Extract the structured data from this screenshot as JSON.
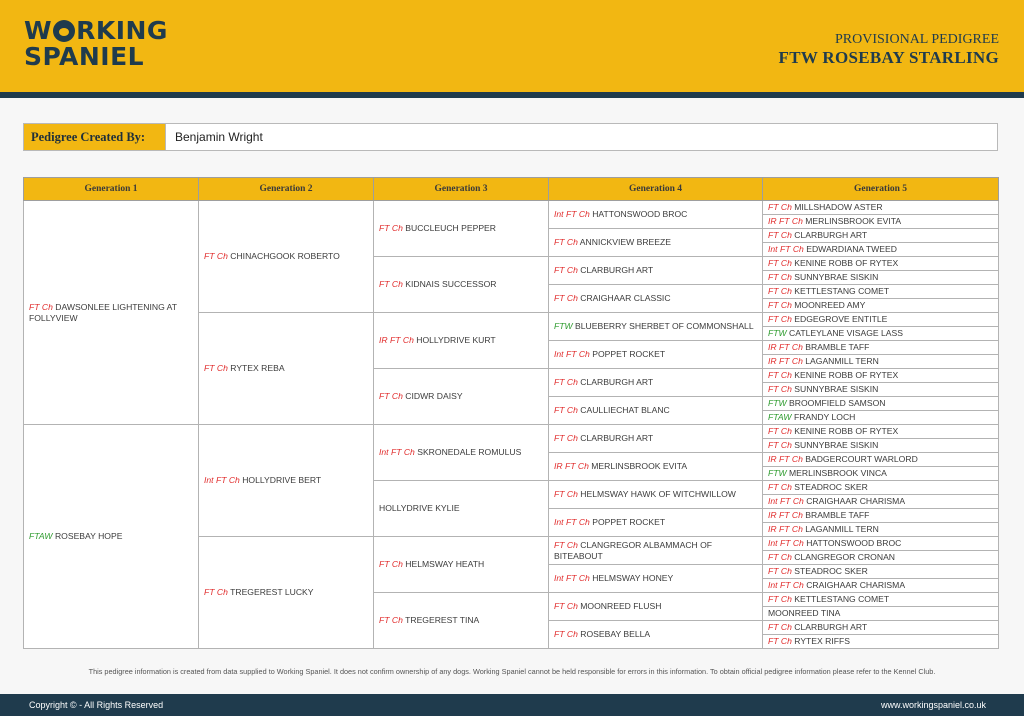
{
  "header": {
    "logo_line1": "WORKING",
    "logo_line2": "SPANIEL",
    "subtitle": "PROVISIONAL PEDIGREE",
    "title": "FTW ROSEBAY STARLING"
  },
  "created_by": {
    "label": "Pedigree Created By:",
    "value": "Benjamin Wright"
  },
  "columns": [
    "Generation 1",
    "Generation 2",
    "Generation 3",
    "Generation 4",
    "Generation 5"
  ],
  "colors": {
    "brand_yellow": "#f2b712",
    "brand_navy": "#1f3b4d",
    "title_red": "#e12c2c",
    "title_green": "#2e9b2e"
  },
  "gen1": [
    {
      "title": "FT Ch",
      "color": "red",
      "name": "DAWSONLEE LIGHTENING AT FOLLYVIEW"
    },
    {
      "title": "FTAW",
      "color": "green",
      "name": "ROSEBAY HOPE"
    }
  ],
  "gen2": [
    {
      "title": "FT Ch",
      "color": "red",
      "name": "CHINACHGOOK ROBERTO"
    },
    {
      "title": "FT Ch",
      "color": "red",
      "name": "RYTEX REBA"
    },
    {
      "title": "Int FT Ch",
      "color": "red",
      "name": "HOLLYDRIVE BERT"
    },
    {
      "title": "FT Ch",
      "color": "red",
      "name": "TREGEREST LUCKY"
    }
  ],
  "gen3": [
    {
      "title": "FT Ch",
      "color": "red",
      "name": "BUCCLEUCH PEPPER"
    },
    {
      "title": "FT Ch",
      "color": "red",
      "name": "KIDNAIS SUCCESSOR"
    },
    {
      "title": "IR FT Ch",
      "color": "red",
      "name": "HOLLYDRIVE KURT"
    },
    {
      "title": "FT Ch",
      "color": "red",
      "name": "CIDWR DAISY"
    },
    {
      "title": "Int FT Ch",
      "color": "red",
      "name": "SKRONEDALE ROMULUS"
    },
    {
      "title": "",
      "color": "",
      "name": "HOLLYDRIVE KYLIE"
    },
    {
      "title": "FT Ch",
      "color": "red",
      "name": "HELMSWAY HEATH"
    },
    {
      "title": "FT Ch",
      "color": "red",
      "name": "TREGEREST TINA"
    }
  ],
  "gen4": [
    {
      "title": "Int FT Ch",
      "color": "red",
      "name": "HATTONSWOOD BROC"
    },
    {
      "title": "FT Ch",
      "color": "red",
      "name": "ANNICKVIEW BREEZE"
    },
    {
      "title": "FT Ch",
      "color": "red",
      "name": "CLARBURGH ART"
    },
    {
      "title": "FT Ch",
      "color": "red",
      "name": "CRAIGHAAR CLASSIC"
    },
    {
      "title": "FTW",
      "color": "green",
      "name": "BLUEBERRY SHERBET OF COMMONSHALL"
    },
    {
      "title": "Int FT Ch",
      "color": "red",
      "name": "POPPET ROCKET"
    },
    {
      "title": "FT Ch",
      "color": "red",
      "name": "CLARBURGH ART"
    },
    {
      "title": "FT Ch",
      "color": "red",
      "name": "CAULLIECHAT BLANC"
    },
    {
      "title": "FT Ch",
      "color": "red",
      "name": "CLARBURGH ART"
    },
    {
      "title": "IR FT Ch",
      "color": "red",
      "name": "MERLINSBROOK EVITA"
    },
    {
      "title": "FT Ch",
      "color": "red",
      "name": "HELMSWAY HAWK OF WITCHWILLOW"
    },
    {
      "title": "Int FT Ch",
      "color": "red",
      "name": "POPPET ROCKET"
    },
    {
      "title": "FT Ch",
      "color": "red",
      "name": "CLANGREGOR ALBAMMACH OF BITEABOUT"
    },
    {
      "title": "Int FT Ch",
      "color": "red",
      "name": "HELMSWAY HONEY"
    },
    {
      "title": "FT Ch",
      "color": "red",
      "name": "MOONREED FLUSH"
    },
    {
      "title": "FT Ch",
      "color": "red",
      "name": "ROSEBAY BELLA"
    }
  ],
  "gen5": [
    {
      "title": "FT Ch",
      "color": "red",
      "name": "MILLSHADOW ASTER"
    },
    {
      "title": "IR FT Ch",
      "color": "red",
      "name": "MERLINSBROOK EVITA"
    },
    {
      "title": "FT Ch",
      "color": "red",
      "name": "CLARBURGH ART"
    },
    {
      "title": "Int FT Ch",
      "color": "red",
      "name": "EDWARDIANA TWEED"
    },
    {
      "title": "FT Ch",
      "color": "red",
      "name": "KENINE ROBB OF RYTEX"
    },
    {
      "title": "FT Ch",
      "color": "red",
      "name": "SUNNYBRAE SISKIN"
    },
    {
      "title": "FT Ch",
      "color": "red",
      "name": "KETTLESTANG COMET"
    },
    {
      "title": "FT Ch",
      "color": "red",
      "name": "MOONREED AMY"
    },
    {
      "title": "FT Ch",
      "color": "red",
      "name": "EDGEGROVE ENTITLE"
    },
    {
      "title": "FTW",
      "color": "green",
      "name": "CATLEYLANE VISAGE LASS"
    },
    {
      "title": "IR FT Ch",
      "color": "red",
      "name": "BRAMBLE TAFF"
    },
    {
      "title": "IR FT Ch",
      "color": "red",
      "name": "LAGANMILL TERN"
    },
    {
      "title": "FT Ch",
      "color": "red",
      "name": "KENINE ROBB OF RYTEX"
    },
    {
      "title": "FT Ch",
      "color": "red",
      "name": "SUNNYBRAE SISKIN"
    },
    {
      "title": "FTW",
      "color": "green",
      "name": "BROOMFIELD SAMSON"
    },
    {
      "title": "FTAW",
      "color": "green",
      "name": "FRANDY LOCH"
    },
    {
      "title": "FT Ch",
      "color": "red",
      "name": "KENINE ROBB OF RYTEX"
    },
    {
      "title": "FT Ch",
      "color": "red",
      "name": "SUNNYBRAE SISKIN"
    },
    {
      "title": "IR FT Ch",
      "color": "red",
      "name": "BADGERCOURT WARLORD"
    },
    {
      "title": "FTW",
      "color": "green",
      "name": "MERLINSBROOK VINCA"
    },
    {
      "title": "FT Ch",
      "color": "red",
      "name": "STEADROC SKER"
    },
    {
      "title": "Int FT Ch",
      "color": "red",
      "name": "CRAIGHAAR CHARISMA"
    },
    {
      "title": "IR FT Ch",
      "color": "red",
      "name": "BRAMBLE TAFF"
    },
    {
      "title": "IR FT Ch",
      "color": "red",
      "name": "LAGANMILL TERN"
    },
    {
      "title": "Int FT Ch",
      "color": "red",
      "name": "HATTONSWOOD BROC"
    },
    {
      "title": "FT Ch",
      "color": "red",
      "name": "CLANGREGOR CRONAN"
    },
    {
      "title": "FT Ch",
      "color": "red",
      "name": "STEADROC SKER"
    },
    {
      "title": "Int FT Ch",
      "color": "red",
      "name": "CRAIGHAAR CHARISMA"
    },
    {
      "title": "FT Ch",
      "color": "red",
      "name": "KETTLESTANG COMET"
    },
    {
      "title": "",
      "color": "",
      "name": "MOONREED TINA"
    },
    {
      "title": "FT Ch",
      "color": "red",
      "name": "CLARBURGH ART"
    },
    {
      "title": "FT Ch",
      "color": "red",
      "name": "RYTEX RIFFS"
    }
  ],
  "disclaimer": "This pedigree information is created from data supplied to Working Spaniel. It does not confirm ownership of any dogs. Working Spaniel cannot be held responsible for errors in this information. To obtain official pedigree information please refer to the Kennel Club.",
  "footer": {
    "copyright": "Copyright © - All Rights Reserved",
    "website": "www.workingspaniel.co.uk"
  }
}
